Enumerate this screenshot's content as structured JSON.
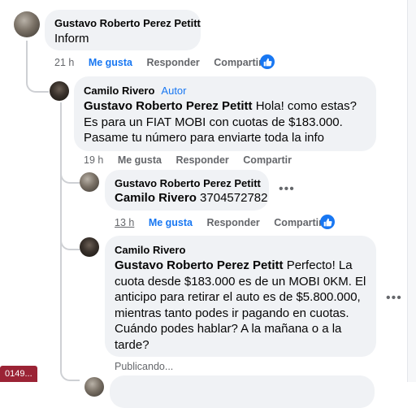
{
  "comments": [
    {
      "author": "Gustavo Roberto Perez Petitt",
      "text": "Inform",
      "time": "21 h",
      "like_label": "Me gusta",
      "reply_label": "Responder",
      "share_label": "Compartir"
    },
    {
      "author": "Camilo Rivero",
      "author_tag": "Autor",
      "mention": "Gustavo Roberto Perez Petitt",
      "text": " Hola! como estas? Es para un FIAT MOBI con cuotas de $183.000. Pasame tu número para enviarte toda la info",
      "time": "19 h",
      "like_label": "Me gusta",
      "reply_label": "Responder",
      "share_label": "Compartir"
    },
    {
      "author": "Gustavo Roberto Perez Petitt",
      "mention": "Camilo Rivero",
      "text": " 3704572782",
      "time": "13 h",
      "like_label": "Me gusta",
      "reply_label": "Responder",
      "share_label": "Compartir"
    },
    {
      "author": "Camilo Rivero",
      "mention": "Gustavo Roberto Perez Petitt",
      "text": " Perfecto! La cuota desde $183.000 es de un MOBI 0KM. El anticipo para retirar el auto es de $5.800.000, mientras tanto podes ir pagando en cuotas. Cuándo podes hablar? A la mañana o a la tarde?",
      "status": "Publicando..."
    }
  ],
  "badge": "0149...",
  "icons": [
    "like-icon",
    "more-options-icon"
  ],
  "colors": {
    "accent": "#1877f2",
    "bubble": "#f0f2f5",
    "muted": "#65676b",
    "badge": "#9b2335"
  }
}
